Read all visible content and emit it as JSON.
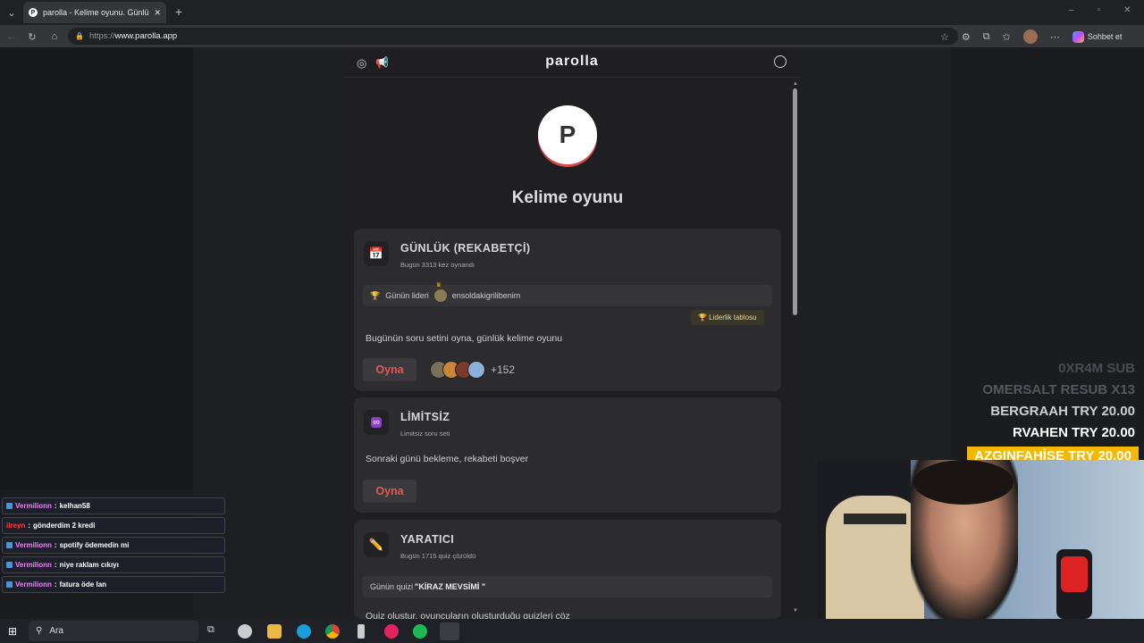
{
  "browser": {
    "tab_title": "parolla - Kelime oyunu. Günlük ke",
    "tab_close": "✕",
    "new_tab": "+",
    "url_scheme": "https://",
    "url_host": "www.parolla.app",
    "chat_button": "Sohbet et"
  },
  "app": {
    "brand": "parolla",
    "logo_letter": "P",
    "title": "Kelime oyunu",
    "cards": [
      {
        "icon": "calendar-icon",
        "title": "GÜNLÜK (REKABETÇİ)",
        "subtitle": "Bugün 3313 kez oynandı",
        "leader_label": "Günün lideri",
        "leader_name": "ensoldakigrilibenim",
        "leaderboard_button": "🏆 Liderlik tablosu",
        "description": "Bugünün soru setini oyna, günlük kelime oyunu",
        "play": "Oyna",
        "players_more": "+152"
      },
      {
        "icon": "infinity-icon",
        "title": "LİMİTSİZ",
        "subtitle": "Limitsiz soru seti",
        "description": "Sonraki günü bekleme, rekabeti boşver",
        "play": "Oyna"
      },
      {
        "icon": "pencil-icon",
        "title": "YARATICI",
        "subtitle": "Bugün 1715 quiz çözüldü",
        "quiz_label": "Günün quizi",
        "quiz_name": "\"KİRAZ MEVSİMİ \"",
        "description": "Quiz oluştur, oyuncuların oluşturduğu quizleri çöz"
      }
    ]
  },
  "stream": {
    "subs": [
      {
        "text": "0XR4M  SUB",
        "color": "#4a4c52"
      },
      {
        "text": "OMERSALT  RESUB X13",
        "color": "#55575d"
      },
      {
        "text": "BERGRAAH  TRY 20.00",
        "color": "#cfcfcf"
      },
      {
        "text": "RVAHEN  TRY 20.00",
        "color": "#ffffff"
      },
      {
        "text": "AZGINFAHİŞE  TRY 20.00",
        "color": "#ffffff"
      }
    ],
    "chat": [
      {
        "user": "Vermilionn",
        "msg": "kelhan58",
        "red": false
      },
      {
        "user": "ilreyn",
        "msg": "gönderdim 2 kredi",
        "red": true
      },
      {
        "user": "Vermilionn",
        "msg": "spotify ödemedin mi",
        "red": false
      },
      {
        "user": "Vermilionn",
        "msg": "niye raklam cıkıyı",
        "red": false
      },
      {
        "user": "Vermilionn",
        "msg": "fatura öde lan",
        "red": false
      }
    ]
  },
  "taskbar": {
    "search_placeholder": "Ara"
  },
  "colors": {
    "accent_red": "#e05a5a",
    "highlight_gold": "#f5b800"
  }
}
